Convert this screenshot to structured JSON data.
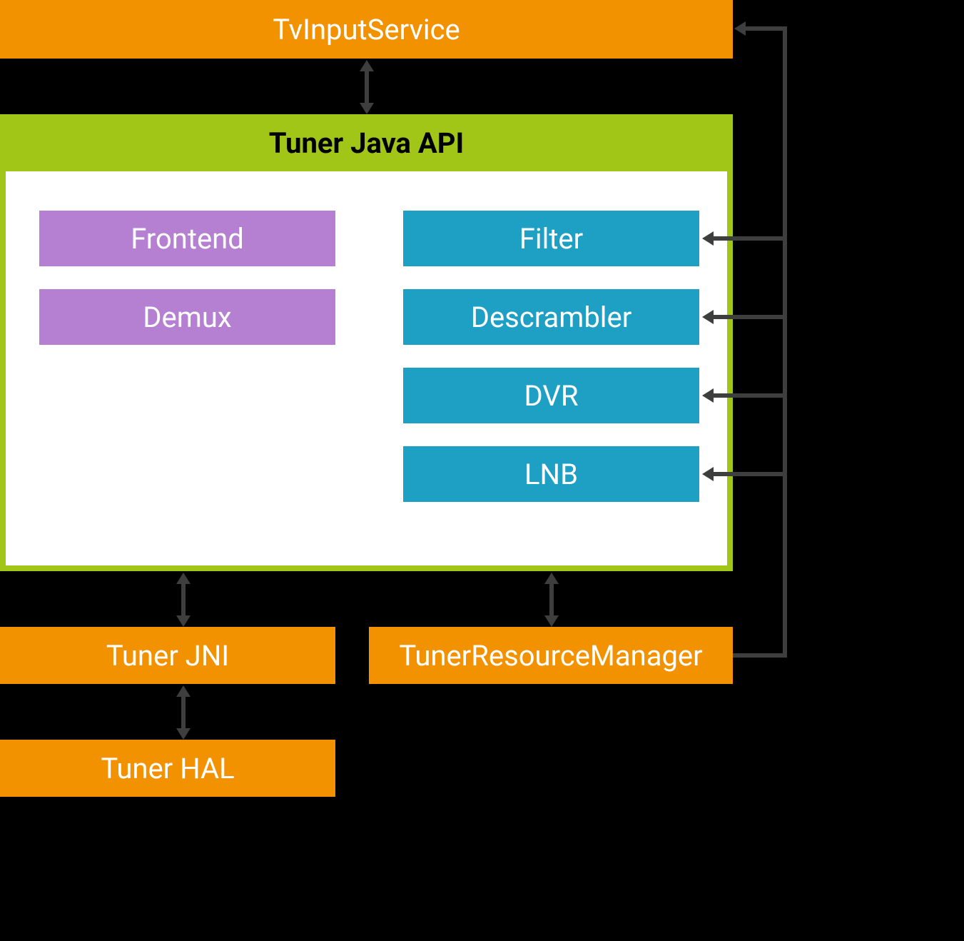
{
  "top": {
    "tv_input_service": "TvInputService"
  },
  "api": {
    "title": "Tuner Java API",
    "left": {
      "frontend": "Frontend",
      "demux": "Demux"
    },
    "right": {
      "filter": "Filter",
      "descrambler": "Descrambler",
      "dvr": "DVR",
      "lnb": "LNB"
    }
  },
  "bottom": {
    "tuner_jni": "Tuner JNI",
    "trm": "TunerResourceManager",
    "tuner_hal": "Tuner HAL"
  }
}
